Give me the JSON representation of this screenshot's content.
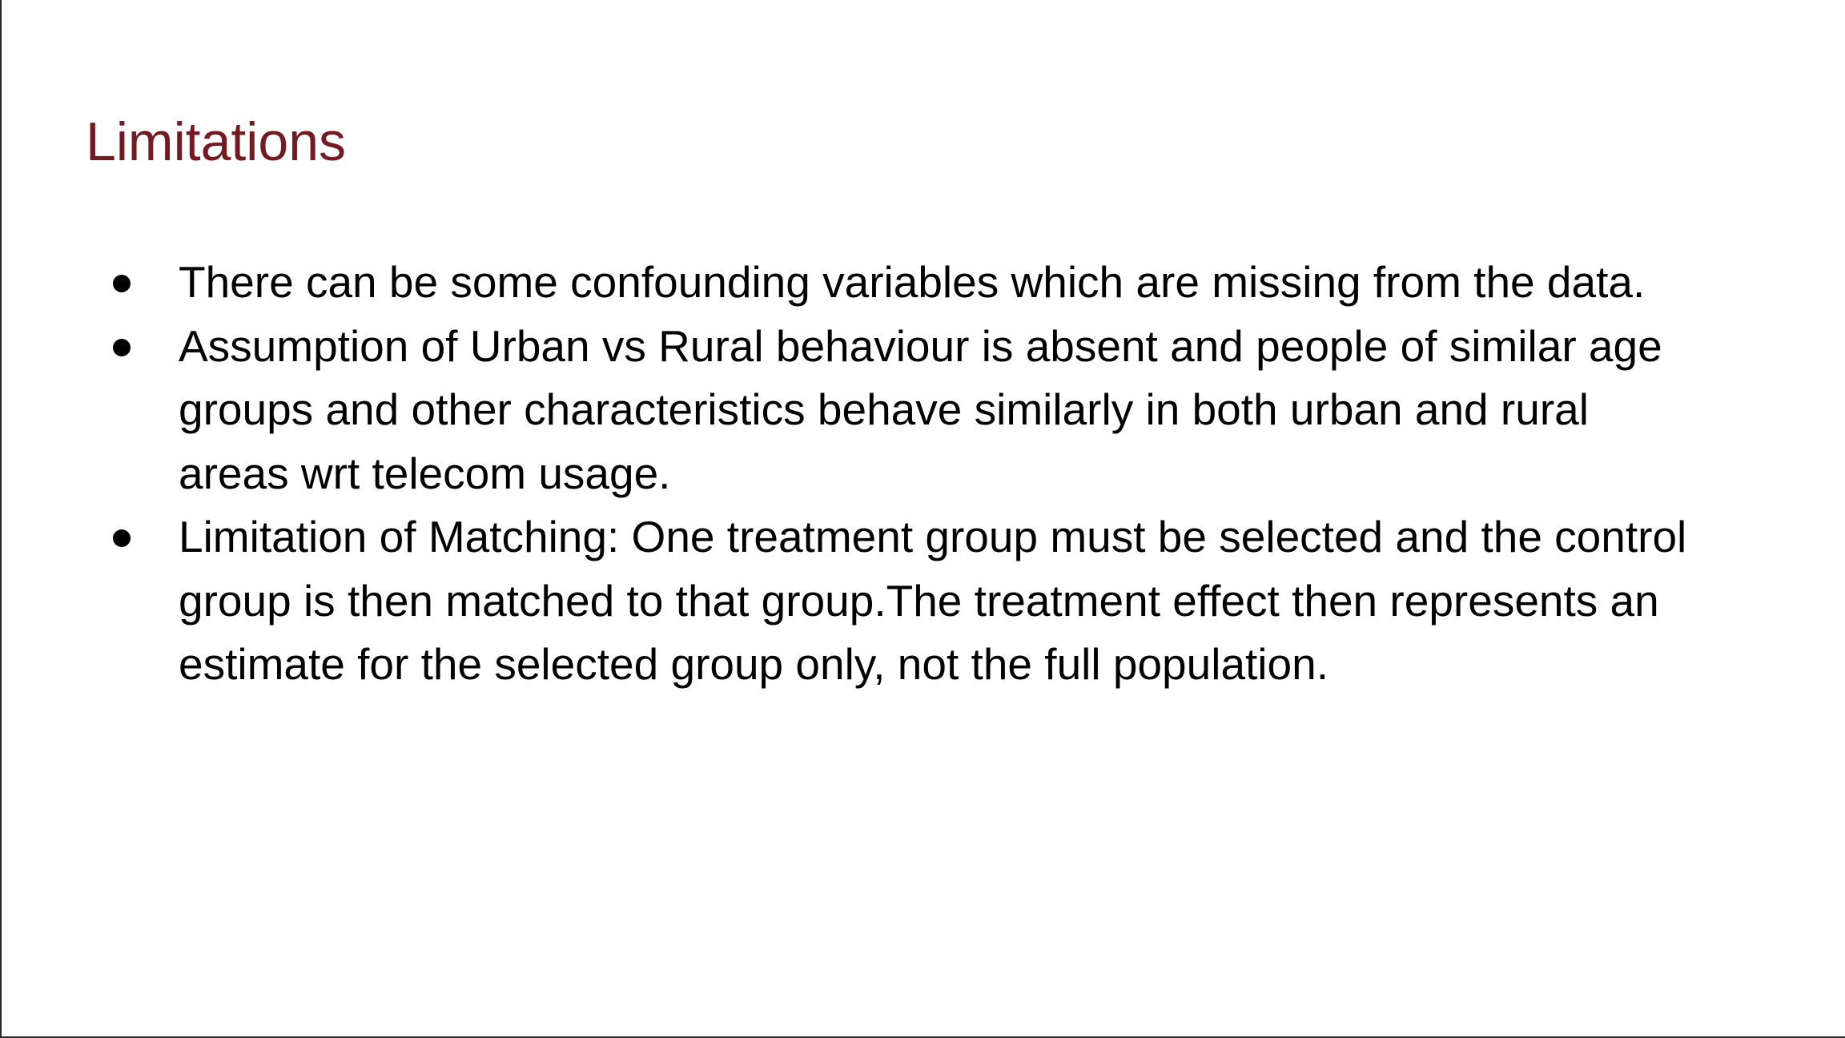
{
  "slide": {
    "title": "Limitations",
    "title_color": "#741b22",
    "bullets": [
      {
        "lines": [
          "There can be some confounding variables which are missing from the data."
        ]
      },
      {
        "lines": [
          "Assumption of Urban vs Rural behaviour is absent and people of similar age",
          "groups and other characteristics behave similarly in both urban and rural",
          "areas wrt telecom usage."
        ]
      },
      {
        "lines": [
          "Limitation of Matching: One treatment group must be selected and the control",
          "group is then matched to that group.The treatment effect then represents an",
          "estimate for the selected group only, not the full population."
        ]
      }
    ]
  }
}
